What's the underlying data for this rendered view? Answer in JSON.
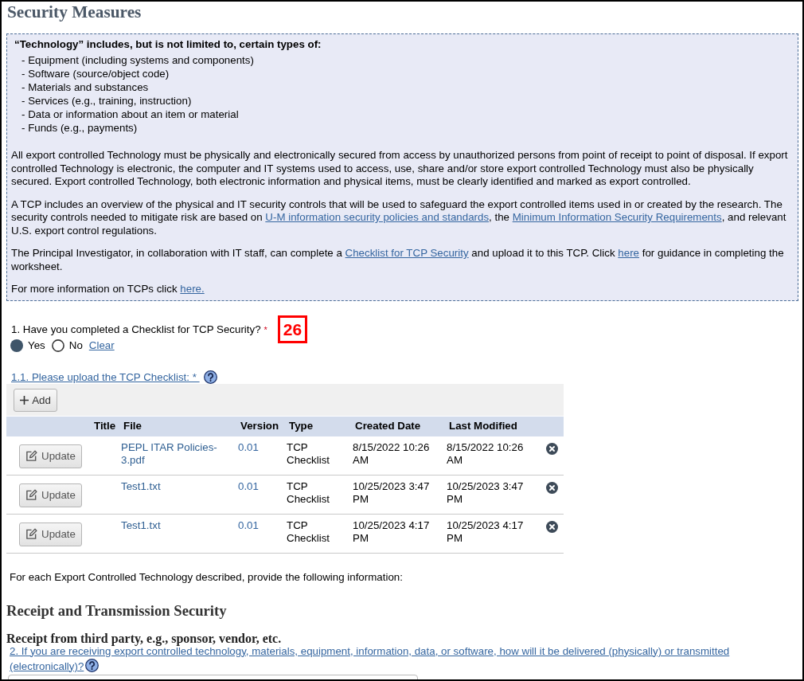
{
  "page_title": "Security Measures",
  "info_box": {
    "heading": "“Technology” includes, but is not limited to, certain types of:",
    "items": [
      "- Equipment (including systems and components)",
      "- Software (source/object code)",
      "- Materials and substances",
      "- Services (e.g., training, instruction)",
      "- Data or information about an item or material",
      "- Funds (e.g., payments)"
    ],
    "paragraphs": [
      [
        {
          "kind": "text",
          "text": "All export controlled Technology must be physically and electronically secured from access by unauthorized persons from point of receipt to point of disposal. If export controlled Technology is electronic, the computer and IT systems used to access, use, share and/or store export controlled Technology must also be physically secured. Export controlled Technology, both electronic information and physical items, must be clearly identified and marked as export controlled."
        }
      ],
      [
        {
          "kind": "text",
          "text": "A TCP includes an overview of the physical and IT security controls that will be used to safeguard the export controlled items used in or created by the research. The security controls needed to mitigate risk are based on "
        },
        {
          "kind": "link",
          "text": "U-M information security policies and standards"
        },
        {
          "kind": "text",
          "text": ", the "
        },
        {
          "kind": "link",
          "text": "Minimum Information Security Requirements"
        },
        {
          "kind": "text",
          "text": ", and relevant U.S. export control regulations."
        }
      ],
      [
        {
          "kind": "text",
          "text": "The Principal Investigator, in collaboration with IT staff, can complete a "
        },
        {
          "kind": "link",
          "text": "Checklist for TCP Security"
        },
        {
          "kind": "text",
          "text": " and upload it to this TCP. Click "
        },
        {
          "kind": "link",
          "text": "here"
        },
        {
          "kind": "text",
          "text": " for guidance in completing the worksheet."
        }
      ],
      [
        {
          "kind": "text",
          "text": "For more information on TCPs click "
        },
        {
          "kind": "link",
          "text": "here."
        }
      ]
    ]
  },
  "question_1": {
    "label": "1. Have you completed a Checklist for TCP Security?",
    "required_mark": "*",
    "options": [
      {
        "label": "Yes",
        "selected": true
      },
      {
        "label": "No",
        "selected": false
      }
    ],
    "clear_link": "Clear"
  },
  "annotation": "26",
  "question_1_1": {
    "label": "1.1. Please upload the TCP Checklist:",
    "required_mark": "*",
    "add_button": "Add",
    "table": {
      "columns": [
        "Title",
        "File",
        "Version",
        "Type",
        "Created Date",
        "Last Modified"
      ],
      "rows": [
        {
          "button": "Update",
          "file": "PEPL ITAR Policies-3.pdf",
          "version": "0.01",
          "type": "TCP Checklist",
          "created_date": "8/15/2022 10:26 AM",
          "last_modified": "8/15/2022 10:26 AM"
        },
        {
          "button": "Update",
          "file": "Test1.txt",
          "version": "0.01",
          "type": "TCP Checklist",
          "created_date": "10/25/2023 3:47 PM",
          "last_modified": "10/25/2023 3:47 PM"
        },
        {
          "button": "Update",
          "file": "Test1.txt",
          "version": "0.01",
          "type": "TCP Checklist",
          "created_date": "10/25/2023 4:17 PM",
          "last_modified": "10/25/2023 4:17 PM"
        }
      ]
    }
  },
  "instruction": "For each Export Controlled Technology described, provide the following information:",
  "section": {
    "heading": "Receipt and Transmission Security",
    "subheading": "Receipt from third party, e.g., sponsor, vendor, etc.",
    "question": "2. If you are receiving export controlled technology, materials, equipment, information, data, or software, how will it be delivered (physically) or transmitted (electronically)?"
  }
}
